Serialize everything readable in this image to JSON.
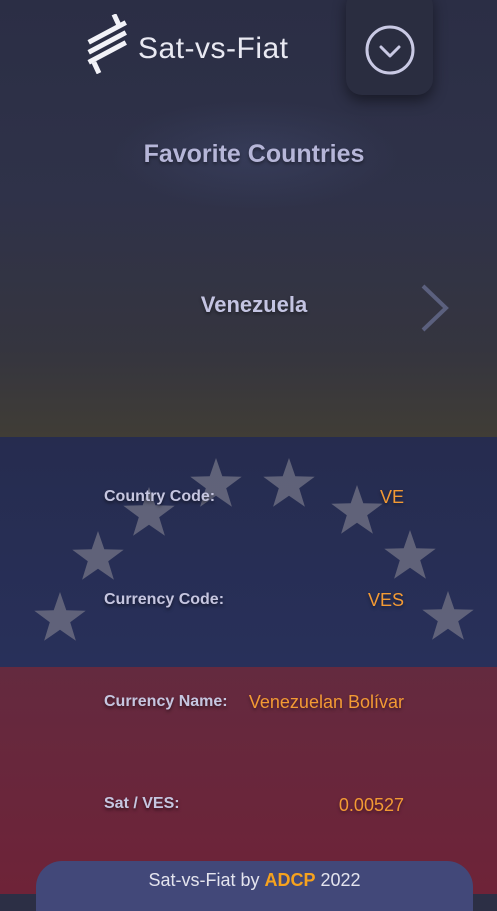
{
  "header": {
    "app_title": "Sat-vs-Fiat",
    "logo_icon": "sat-stack-logo-icon",
    "menu_icon": "chevron-down-circle-icon"
  },
  "favorites": {
    "title": "Favorite Countries",
    "current_country": "Venezuela",
    "next_icon": "chevron-right-icon"
  },
  "details": {
    "country_code_label": "Country Code:",
    "country_code_value": "VE",
    "currency_code_label": "Currency Code:",
    "currency_code_value": "VES",
    "currency_name_label": "Currency Name:",
    "currency_name_value": "Venezuelan Bolívar",
    "sat_rate_label": "Sat / VES:",
    "sat_rate_value": "0.00527"
  },
  "footer": {
    "prefix": "Sat-vs-Fiat by",
    "brand": "ADCP",
    "year": "2022"
  },
  "colors": {
    "accent": "#f39a34",
    "flag_yellow": "#403d36",
    "flag_blue": "#28305a",
    "flag_red": "#6e2338",
    "footer_bg": "#424879"
  }
}
